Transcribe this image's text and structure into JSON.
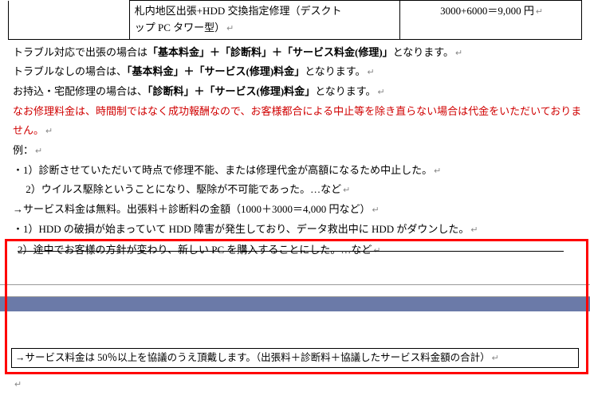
{
  "table": {
    "row": {
      "label": "",
      "desc_line1": "札内地区出張+HDD 交換指定修理（デスクト",
      "desc_line2": "ップ PC タワー型）",
      "price": "3000+6000＝9,000 円"
    }
  },
  "body": {
    "p1_a": "トラブル対応で出張の場合は",
    "p1_b": "「基本料金」＋「診断料」＋「サービス料金(修理)」",
    "p1_c": "となります。",
    "p2_a": "トラブルなしの場合は、",
    "p2_b": "「基本料金」＋「サービス(修理)料金」",
    "p2_c": "となります。",
    "p3_a": "お持込・宅配修理の場合は、",
    "p3_b": "「診断料」＋「サービス(修理)料金」",
    "p3_c": "となります。",
    "p4": "なお修理料金は、時間制ではなく成功報酬なので、お客様都合による中止等を除き直らない場合は代金をいただいておりません。",
    "p5": "例：",
    "p6": "・1）診断させていただいて時点で修理不能、または修理代金が高額になるため中止した。",
    "p7": "　 2）ウイルス駆除ということになり、駆除が不可能であった。…など",
    "p8": "→サービス料金は無料。出張料＋診断料の金額（1000＋3000＝4,000 円など）",
    "p9": "・1）HDD の破損が始まっていて HDD 障害が発生しており、データ救出中に HDD がダウンした。",
    "p10": "2）途中でお客様の方針が変わり、新しい PC を購入することにした。…など",
    "boxed": "→サービス料金は 50％以上を協議のうえ頂戴します。（出張料＋診断料＋協議したサービス料金額の合計）"
  },
  "marks": {
    "ret": "↵"
  }
}
